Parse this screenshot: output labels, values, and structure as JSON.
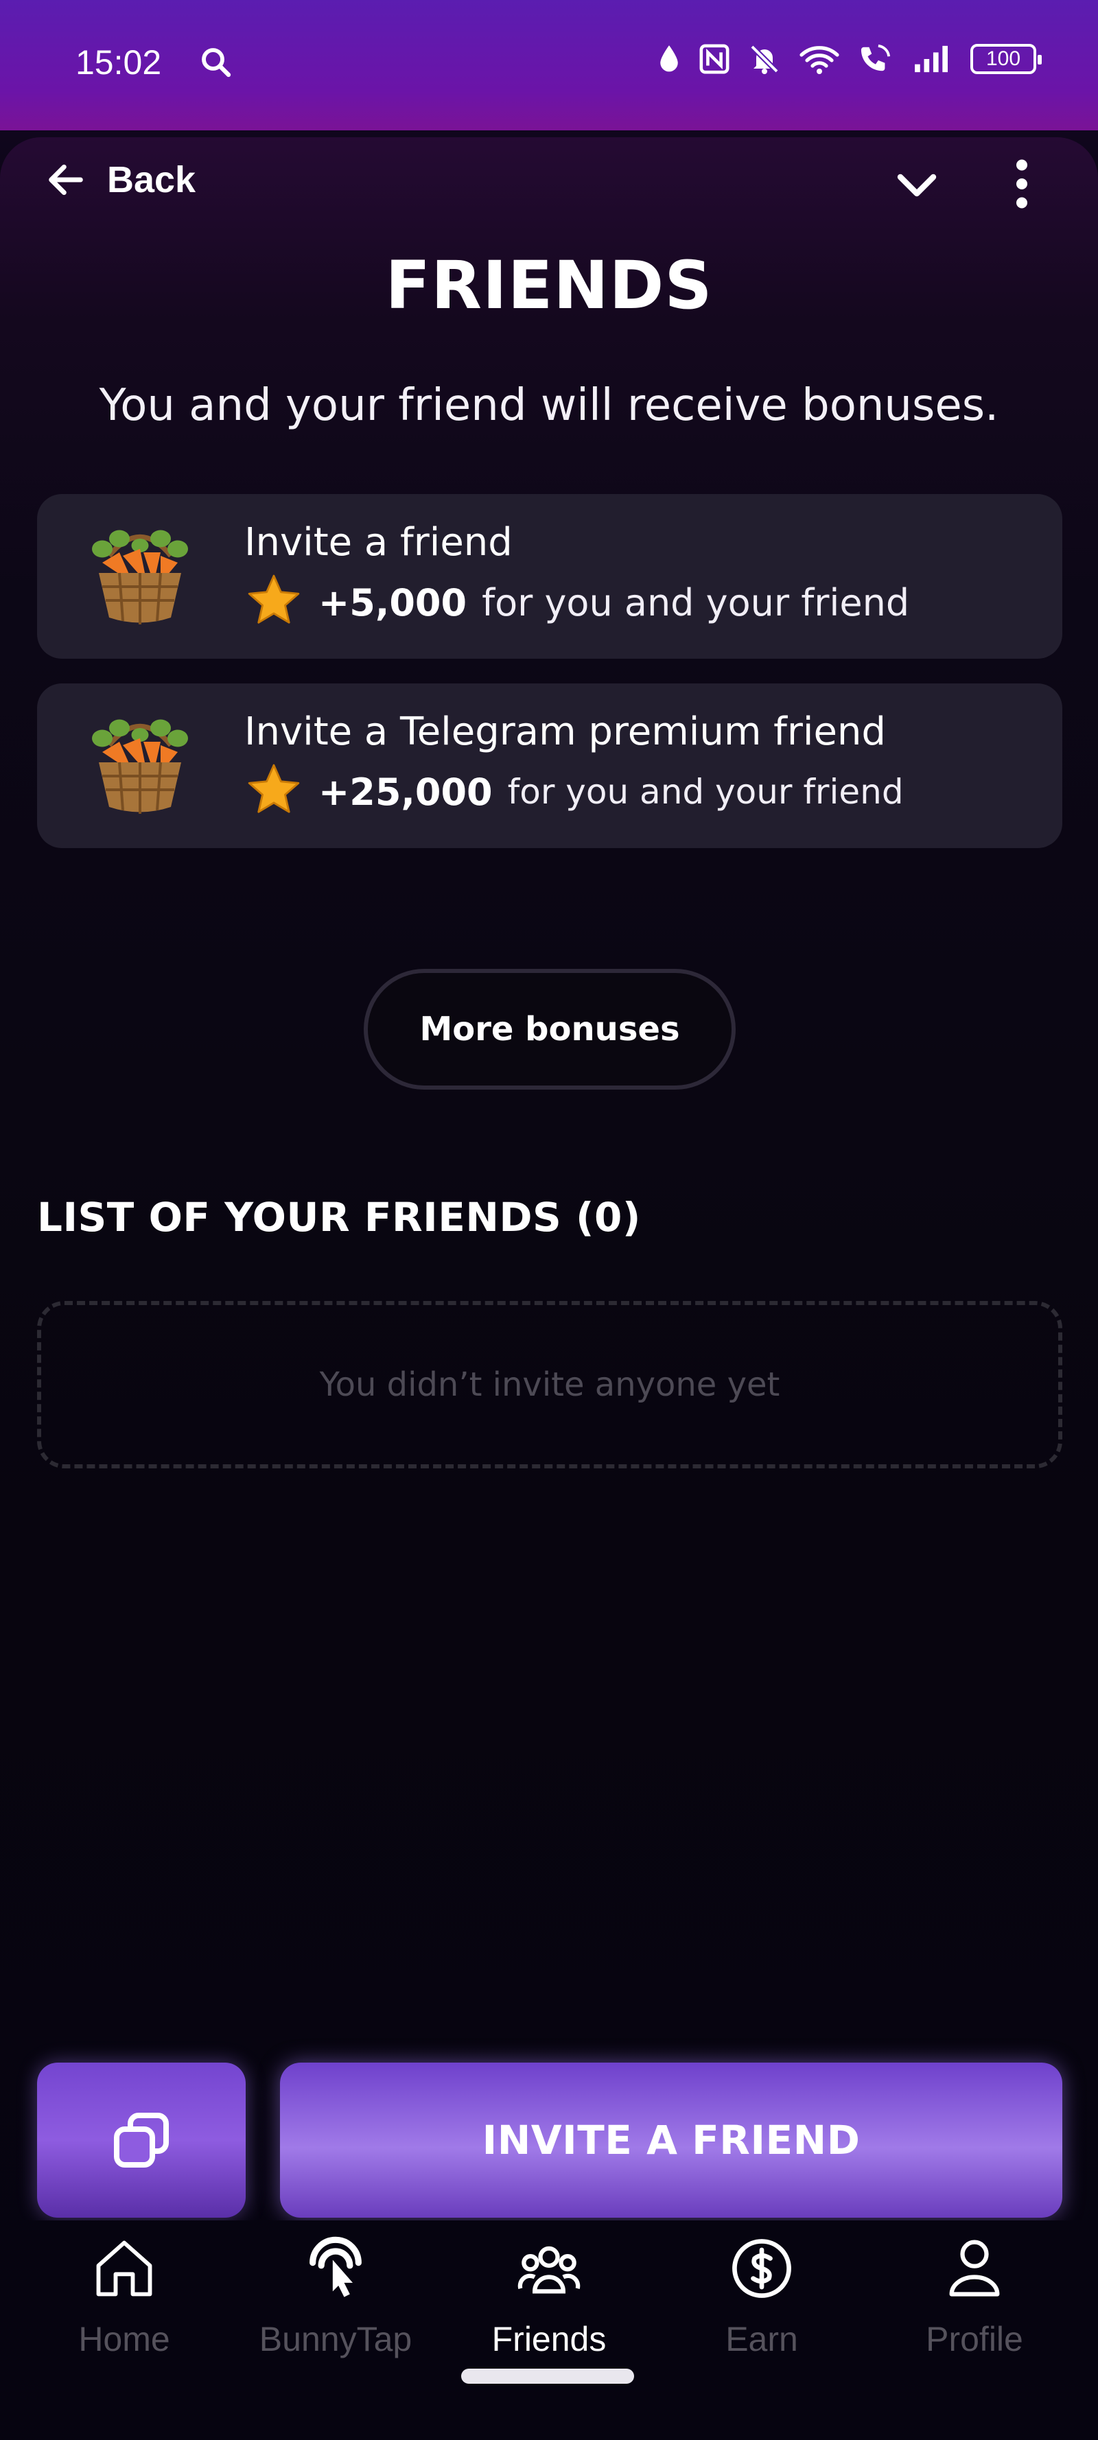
{
  "status_bar": {
    "time": "15:02",
    "battery": "100"
  },
  "header": {
    "back_label": "Back"
  },
  "page": {
    "title": "FRIENDS",
    "subtitle": "You and your friend will receive bonuses."
  },
  "bonuses": [
    {
      "title": "Invite a friend",
      "amount": "+5,000",
      "description": "for you and your friend",
      "icon": "carrot-basket-icon"
    },
    {
      "title": "Invite a Telegram premium friend",
      "amount": "+25,000",
      "description": "for you and your friend",
      "icon": "carrot-basket-icon"
    }
  ],
  "more_bonuses_label": "More bonuses",
  "friends_list": {
    "header": "LIST OF YOUR FRIENDS (0)",
    "empty_text": "You didn’t invite anyone yet"
  },
  "actions": {
    "invite_label": "INVITE A FRIEND",
    "copy_icon": "copy-icon"
  },
  "nav": {
    "items": [
      {
        "label": "Home",
        "icon": "home-icon",
        "active": false
      },
      {
        "label": "BunnyTap",
        "icon": "tap-icon",
        "active": false
      },
      {
        "label": "Friends",
        "icon": "friends-icon",
        "active": true
      },
      {
        "label": "Earn",
        "icon": "dollar-icon",
        "active": false
      },
      {
        "label": "Profile",
        "icon": "profile-icon",
        "active": false
      }
    ]
  },
  "colors": {
    "accent": "#8e5ce0",
    "card": "#221e2e",
    "background": "#070412",
    "status_bar": "#5b1db0"
  }
}
